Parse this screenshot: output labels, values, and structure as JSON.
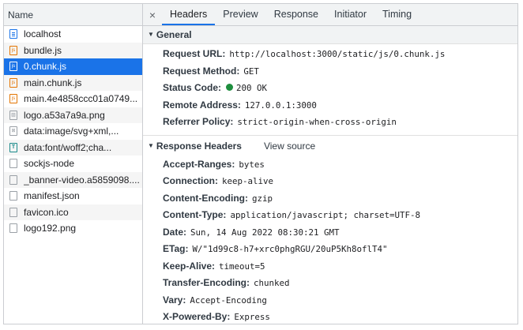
{
  "left_panel": {
    "header": "Name",
    "items": [
      {
        "name": "localhost",
        "icon": "document-icon"
      },
      {
        "name": "bundle.js",
        "icon": "script-icon"
      },
      {
        "name": "0.chunk.js",
        "icon": "script-icon",
        "selected": true
      },
      {
        "name": "main.chunk.js",
        "icon": "script-icon"
      },
      {
        "name": "main.4e4858ccc01a0749...",
        "icon": "script-icon"
      },
      {
        "name": "logo.a53a7a9a.png",
        "icon": "image-icon"
      },
      {
        "name": "data:image/svg+xml,...",
        "icon": "image-icon"
      },
      {
        "name": "data:font/woff2;cha...",
        "icon": "font-icon"
      },
      {
        "name": "sockjs-node",
        "icon": "file-icon"
      },
      {
        "name": "_banner-video.a5859098....",
        "icon": "file-icon"
      },
      {
        "name": "manifest.json",
        "icon": "file-icon"
      },
      {
        "name": "favicon.ico",
        "icon": "file-icon"
      },
      {
        "name": "logo192.png",
        "icon": "file-icon"
      }
    ]
  },
  "tabs": {
    "close": "×",
    "items": [
      "Headers",
      "Preview",
      "Response",
      "Initiator",
      "Timing"
    ],
    "active": "Headers"
  },
  "general": {
    "title": "General",
    "request_url": {
      "label": "Request URL:",
      "value": "http://localhost:3000/static/js/0.chunk.js"
    },
    "request_method": {
      "label": "Request Method:",
      "value": "GET"
    },
    "status_code": {
      "label": "Status Code:",
      "value": "200 OK",
      "status_color": "#1e8e3e"
    },
    "remote_address": {
      "label": "Remote Address:",
      "value": "127.0.0.1:3000"
    },
    "referrer_policy": {
      "label": "Referrer Policy:",
      "value": "strict-origin-when-cross-origin"
    }
  },
  "response_headers": {
    "title": "Response Headers",
    "view_source": "View source",
    "items": [
      {
        "label": "Accept-Ranges:",
        "value": "bytes"
      },
      {
        "label": "Connection:",
        "value": "keep-alive"
      },
      {
        "label": "Content-Encoding:",
        "value": "gzip"
      },
      {
        "label": "Content-Type:",
        "value": "application/javascript; charset=UTF-8"
      },
      {
        "label": "Date:",
        "value": "Sun, 14 Aug 2022 08:30:21 GMT"
      },
      {
        "label": "ETag:",
        "value": "W/\"1d99c8-h7+xrc0phgRGU/20uP5Kh8oflT4\""
      },
      {
        "label": "Keep-Alive:",
        "value": "timeout=5"
      },
      {
        "label": "Transfer-Encoding:",
        "value": "chunked"
      },
      {
        "label": "Vary:",
        "value": "Accept-Encoding"
      },
      {
        "label": "X-Powered-By:",
        "value": "Express"
      }
    ]
  },
  "colors": {
    "accent": "#1a73e8",
    "status_ok": "#1e8e3e",
    "js_icon": "#e37400"
  }
}
